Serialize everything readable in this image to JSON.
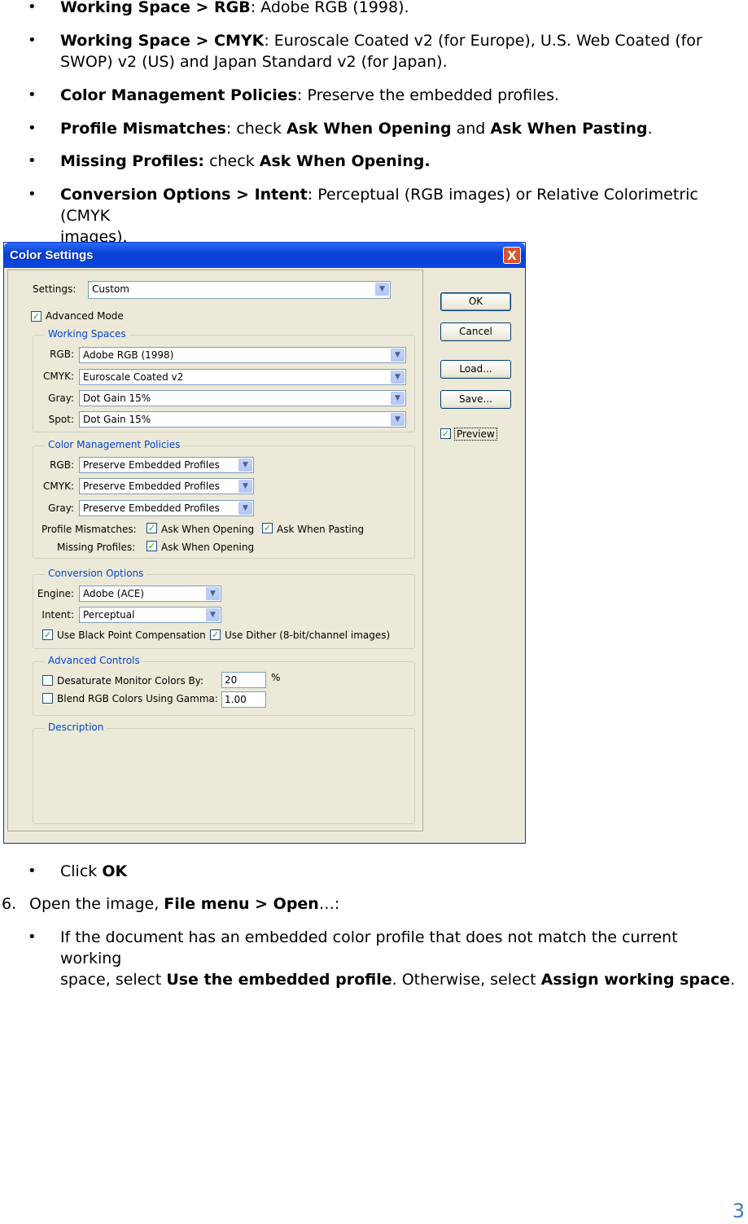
{
  "bullets": [
    {
      "bold": "Working Space > RGB",
      "rest": ": Adobe RGB (1998)."
    },
    {
      "bold": "Working Space > CMYK",
      "rest": ": Euroscale Coated v2 (for Europe), U.S. Web Coated (for",
      "line2": "SWOP) v2 (US) and Japan Standard v2 (for Japan)."
    },
    {
      "bold": "Color Management Policies",
      "rest": ": Preserve the embedded profiles."
    },
    {
      "bold": "Profile Mismatches",
      "rest": ": check ",
      "bold2": "Ask When Opening",
      "rest2": " and ",
      "bold3": "Ask When Pasting",
      "rest3": "."
    },
    {
      "bold": "Missing Profiles:",
      "rest": " check ",
      "bold2": "Ask When Opening."
    },
    {
      "bold": "Conversion Options > Intent",
      "rest": ": Perceptual (RGB images) or Relative Colorimetric (CMYK",
      "line2": "images)."
    }
  ],
  "after": {
    "click_prefix": "Click ",
    "click_ok": "OK",
    "step_num": "6.",
    "step_prefix": "Open the image, ",
    "step_bold": "File menu > Open",
    "step_suffix": "…:",
    "sub_line1": "If the document has an embedded color profile that does not match the current working",
    "sub_prefix": "space, select ",
    "sub_bold1": "Use the embedded profile",
    "sub_mid": ". Otherwise, select ",
    "sub_bold2": "Assign working space",
    "sub_end": "."
  },
  "page_number": "3",
  "dialog": {
    "title": "Color Settings",
    "close": "X",
    "settings_label": "Settings:",
    "settings_value": "Custom",
    "advanced_mode": "Advanced Mode",
    "working_spaces": {
      "title": "Working Spaces",
      "rows": [
        {
          "label": "RGB:",
          "value": "Adobe RGB (1998)"
        },
        {
          "label": "CMYK:",
          "value": "Euroscale Coated v2"
        },
        {
          "label": "Gray:",
          "value": "Dot Gain 15%"
        },
        {
          "label": "Spot:",
          "value": "Dot Gain 15%"
        }
      ]
    },
    "policies": {
      "title": "Color Management Policies",
      "rows": [
        {
          "label": "RGB:",
          "value": "Preserve Embedded Profiles"
        },
        {
          "label": "CMYK:",
          "value": "Preserve Embedded Profiles"
        },
        {
          "label": "Gray:",
          "value": "Preserve Embedded Profiles"
        }
      ],
      "mismatch_label": "Profile Mismatches:",
      "ask_opening": "Ask When Opening",
      "ask_pasting": "Ask When Pasting",
      "missing_label": "Missing Profiles:",
      "missing_ask": "Ask When Opening"
    },
    "conversion": {
      "title": "Conversion Options",
      "engine_label": "Engine:",
      "engine_value": "Adobe (ACE)",
      "intent_label": "Intent:",
      "intent_value": "Perceptual",
      "bpc": "Use Black Point Compensation",
      "dither": "Use Dither (8-bit/channel images)"
    },
    "advanced": {
      "title": "Advanced Controls",
      "desat": "Desaturate Monitor Colors By:",
      "desat_value": "20",
      "desat_unit": "%",
      "blend": "Blend RGB Colors Using Gamma:",
      "blend_value": "1.00"
    },
    "description_title": "Description",
    "buttons": {
      "ok": "OK",
      "cancel": "Cancel",
      "load": "Load...",
      "save": "Save..."
    },
    "preview": "Preview"
  }
}
